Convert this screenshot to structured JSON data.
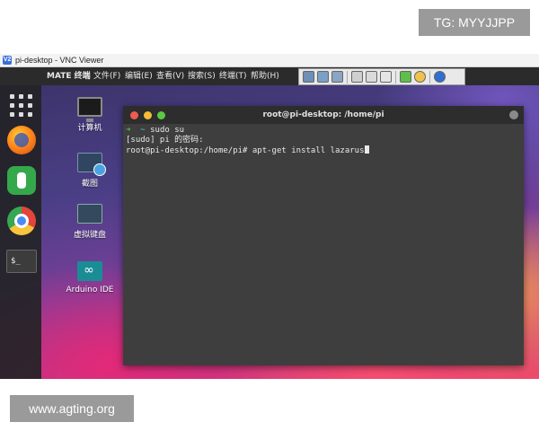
{
  "watermarks": {
    "top_right": "TG: MYYJJPP",
    "bottom_left": "www.agting.org"
  },
  "vnc": {
    "window_title": "pi-desktop - VNC Viewer",
    "app_icon_glyph": "V2"
  },
  "panel": {
    "app_name": "MATE 终端",
    "menu": [
      "文件(F)",
      "编辑(E)",
      "查看(V)",
      "搜索(S)",
      "终端(T)",
      "帮助(H)"
    ]
  },
  "toolbar": {
    "buttons": [
      "connection-info-icon",
      "save-icon",
      "options-icon",
      "tools-icon",
      "fullscreen-icon",
      "send-keys-icon",
      "transfer-icon",
      "chat-icon",
      "about-icon"
    ]
  },
  "dock": {
    "items": [
      "apps-grid-icon",
      "firefox-icon",
      "settings-icon",
      "chromium-icon",
      "terminal-icon"
    ],
    "terminal_label": "$_"
  },
  "desktop_icons": [
    {
      "label": "计算机",
      "icon": "computer-icon"
    },
    {
      "label": "截图",
      "icon": "screenshot-icon"
    },
    {
      "label": "虚拟键盘",
      "icon": "virtual-keyboard-icon"
    },
    {
      "label": "Arduino IDE",
      "icon": "arduino-icon"
    }
  ],
  "terminal": {
    "title": "root@pi-desktop: /home/pi",
    "line1_arrow": "➜",
    "line1_tilde": "~",
    "line1_cmd": " sudo su",
    "line2": "[sudo] pi 的密码:",
    "line3": "root@pi-desktop:/home/pi# apt-get install lazarus"
  },
  "colors": {
    "terminal_bg": "#3e3e3e",
    "prompt_green": "#4fc34f",
    "prompt_cyan": "#4fc8d8"
  }
}
